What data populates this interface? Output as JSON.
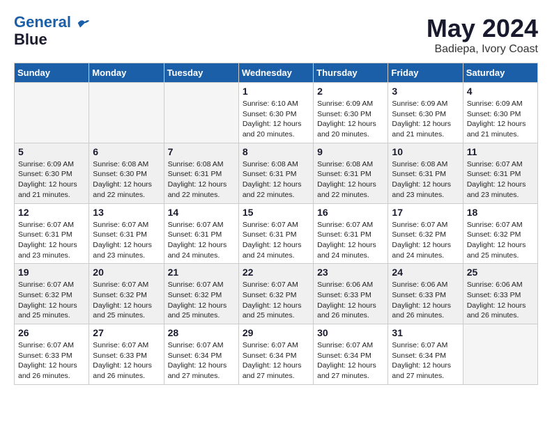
{
  "header": {
    "logo_line1": "General",
    "logo_line2": "Blue",
    "month": "May 2024",
    "location": "Badiepa, Ivory Coast"
  },
  "weekdays": [
    "Sunday",
    "Monday",
    "Tuesday",
    "Wednesday",
    "Thursday",
    "Friday",
    "Saturday"
  ],
  "weeks": [
    [
      {
        "day": "",
        "info": ""
      },
      {
        "day": "",
        "info": ""
      },
      {
        "day": "",
        "info": ""
      },
      {
        "day": "1",
        "info": "Sunrise: 6:10 AM\nSunset: 6:30 PM\nDaylight: 12 hours\nand 20 minutes."
      },
      {
        "day": "2",
        "info": "Sunrise: 6:09 AM\nSunset: 6:30 PM\nDaylight: 12 hours\nand 20 minutes."
      },
      {
        "day": "3",
        "info": "Sunrise: 6:09 AM\nSunset: 6:30 PM\nDaylight: 12 hours\nand 21 minutes."
      },
      {
        "day": "4",
        "info": "Sunrise: 6:09 AM\nSunset: 6:30 PM\nDaylight: 12 hours\nand 21 minutes."
      }
    ],
    [
      {
        "day": "5",
        "info": "Sunrise: 6:09 AM\nSunset: 6:30 PM\nDaylight: 12 hours\nand 21 minutes."
      },
      {
        "day": "6",
        "info": "Sunrise: 6:08 AM\nSunset: 6:30 PM\nDaylight: 12 hours\nand 22 minutes."
      },
      {
        "day": "7",
        "info": "Sunrise: 6:08 AM\nSunset: 6:31 PM\nDaylight: 12 hours\nand 22 minutes."
      },
      {
        "day": "8",
        "info": "Sunrise: 6:08 AM\nSunset: 6:31 PM\nDaylight: 12 hours\nand 22 minutes."
      },
      {
        "day": "9",
        "info": "Sunrise: 6:08 AM\nSunset: 6:31 PM\nDaylight: 12 hours\nand 22 minutes."
      },
      {
        "day": "10",
        "info": "Sunrise: 6:08 AM\nSunset: 6:31 PM\nDaylight: 12 hours\nand 23 minutes."
      },
      {
        "day": "11",
        "info": "Sunrise: 6:07 AM\nSunset: 6:31 PM\nDaylight: 12 hours\nand 23 minutes."
      }
    ],
    [
      {
        "day": "12",
        "info": "Sunrise: 6:07 AM\nSunset: 6:31 PM\nDaylight: 12 hours\nand 23 minutes."
      },
      {
        "day": "13",
        "info": "Sunrise: 6:07 AM\nSunset: 6:31 PM\nDaylight: 12 hours\nand 23 minutes."
      },
      {
        "day": "14",
        "info": "Sunrise: 6:07 AM\nSunset: 6:31 PM\nDaylight: 12 hours\nand 24 minutes."
      },
      {
        "day": "15",
        "info": "Sunrise: 6:07 AM\nSunset: 6:31 PM\nDaylight: 12 hours\nand 24 minutes."
      },
      {
        "day": "16",
        "info": "Sunrise: 6:07 AM\nSunset: 6:31 PM\nDaylight: 12 hours\nand 24 minutes."
      },
      {
        "day": "17",
        "info": "Sunrise: 6:07 AM\nSunset: 6:32 PM\nDaylight: 12 hours\nand 24 minutes."
      },
      {
        "day": "18",
        "info": "Sunrise: 6:07 AM\nSunset: 6:32 PM\nDaylight: 12 hours\nand 25 minutes."
      }
    ],
    [
      {
        "day": "19",
        "info": "Sunrise: 6:07 AM\nSunset: 6:32 PM\nDaylight: 12 hours\nand 25 minutes."
      },
      {
        "day": "20",
        "info": "Sunrise: 6:07 AM\nSunset: 6:32 PM\nDaylight: 12 hours\nand 25 minutes."
      },
      {
        "day": "21",
        "info": "Sunrise: 6:07 AM\nSunset: 6:32 PM\nDaylight: 12 hours\nand 25 minutes."
      },
      {
        "day": "22",
        "info": "Sunrise: 6:07 AM\nSunset: 6:32 PM\nDaylight: 12 hours\nand 25 minutes."
      },
      {
        "day": "23",
        "info": "Sunrise: 6:06 AM\nSunset: 6:33 PM\nDaylight: 12 hours\nand 26 minutes."
      },
      {
        "day": "24",
        "info": "Sunrise: 6:06 AM\nSunset: 6:33 PM\nDaylight: 12 hours\nand 26 minutes."
      },
      {
        "day": "25",
        "info": "Sunrise: 6:06 AM\nSunset: 6:33 PM\nDaylight: 12 hours\nand 26 minutes."
      }
    ],
    [
      {
        "day": "26",
        "info": "Sunrise: 6:07 AM\nSunset: 6:33 PM\nDaylight: 12 hours\nand 26 minutes."
      },
      {
        "day": "27",
        "info": "Sunrise: 6:07 AM\nSunset: 6:33 PM\nDaylight: 12 hours\nand 26 minutes."
      },
      {
        "day": "28",
        "info": "Sunrise: 6:07 AM\nSunset: 6:34 PM\nDaylight: 12 hours\nand 27 minutes."
      },
      {
        "day": "29",
        "info": "Sunrise: 6:07 AM\nSunset: 6:34 PM\nDaylight: 12 hours\nand 27 minutes."
      },
      {
        "day": "30",
        "info": "Sunrise: 6:07 AM\nSunset: 6:34 PM\nDaylight: 12 hours\nand 27 minutes."
      },
      {
        "day": "31",
        "info": "Sunrise: 6:07 AM\nSunset: 6:34 PM\nDaylight: 12 hours\nand 27 minutes."
      },
      {
        "day": "",
        "info": ""
      }
    ]
  ]
}
